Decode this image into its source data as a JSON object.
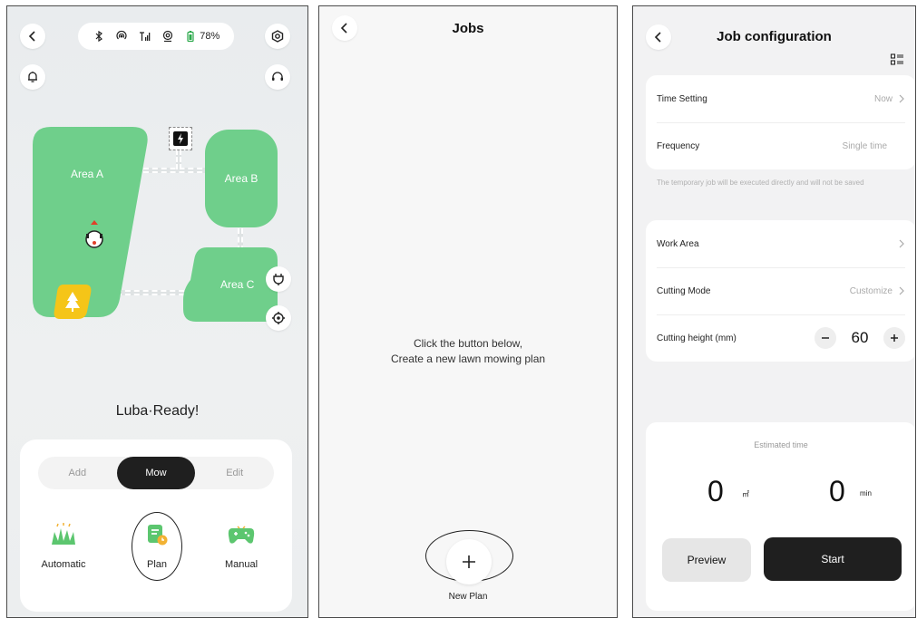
{
  "screen1": {
    "status": {
      "battery": "78%"
    },
    "map": {
      "areas": [
        {
          "label": "Area A"
        },
        {
          "label": "Area B"
        },
        {
          "label": "Area C"
        }
      ]
    },
    "robot_status": "Luba·Ready!",
    "segment": [
      "Add",
      "Mow",
      "Edit"
    ],
    "segment_active": "Mow",
    "modes": [
      {
        "label": "Automatic",
        "icon": "grass-icon"
      },
      {
        "label": "Plan",
        "icon": "plan-icon"
      },
      {
        "label": "Manual",
        "icon": "gamepad-icon"
      }
    ],
    "colors": {
      "area": "#6fcf8b",
      "accent_dark": "#1f1f1f",
      "tree_badge": "#f5c518"
    }
  },
  "screen2": {
    "title": "Jobs",
    "empty_line1": "Click the button below,",
    "empty_line2": "Create a new lawn mowing plan",
    "new_plan_label": "New Plan"
  },
  "screen3": {
    "title": "Job configuration",
    "time_setting": {
      "label": "Time Setting",
      "value": "Now"
    },
    "frequency": {
      "label": "Frequency",
      "value": "Single time"
    },
    "note": "The temporary job will be executed directly and will not be saved",
    "work_area": {
      "label": "Work Area"
    },
    "cutting_mode": {
      "label": "Cutting Mode",
      "value": "Customize"
    },
    "cutting_height": {
      "label": "Cutting height (mm)",
      "value": "60"
    },
    "estimated_label": "Estimated time",
    "area_value": "0",
    "area_unit": "㎡",
    "time_value": "0",
    "time_unit": "min",
    "preview_label": "Preview",
    "start_label": "Start"
  }
}
